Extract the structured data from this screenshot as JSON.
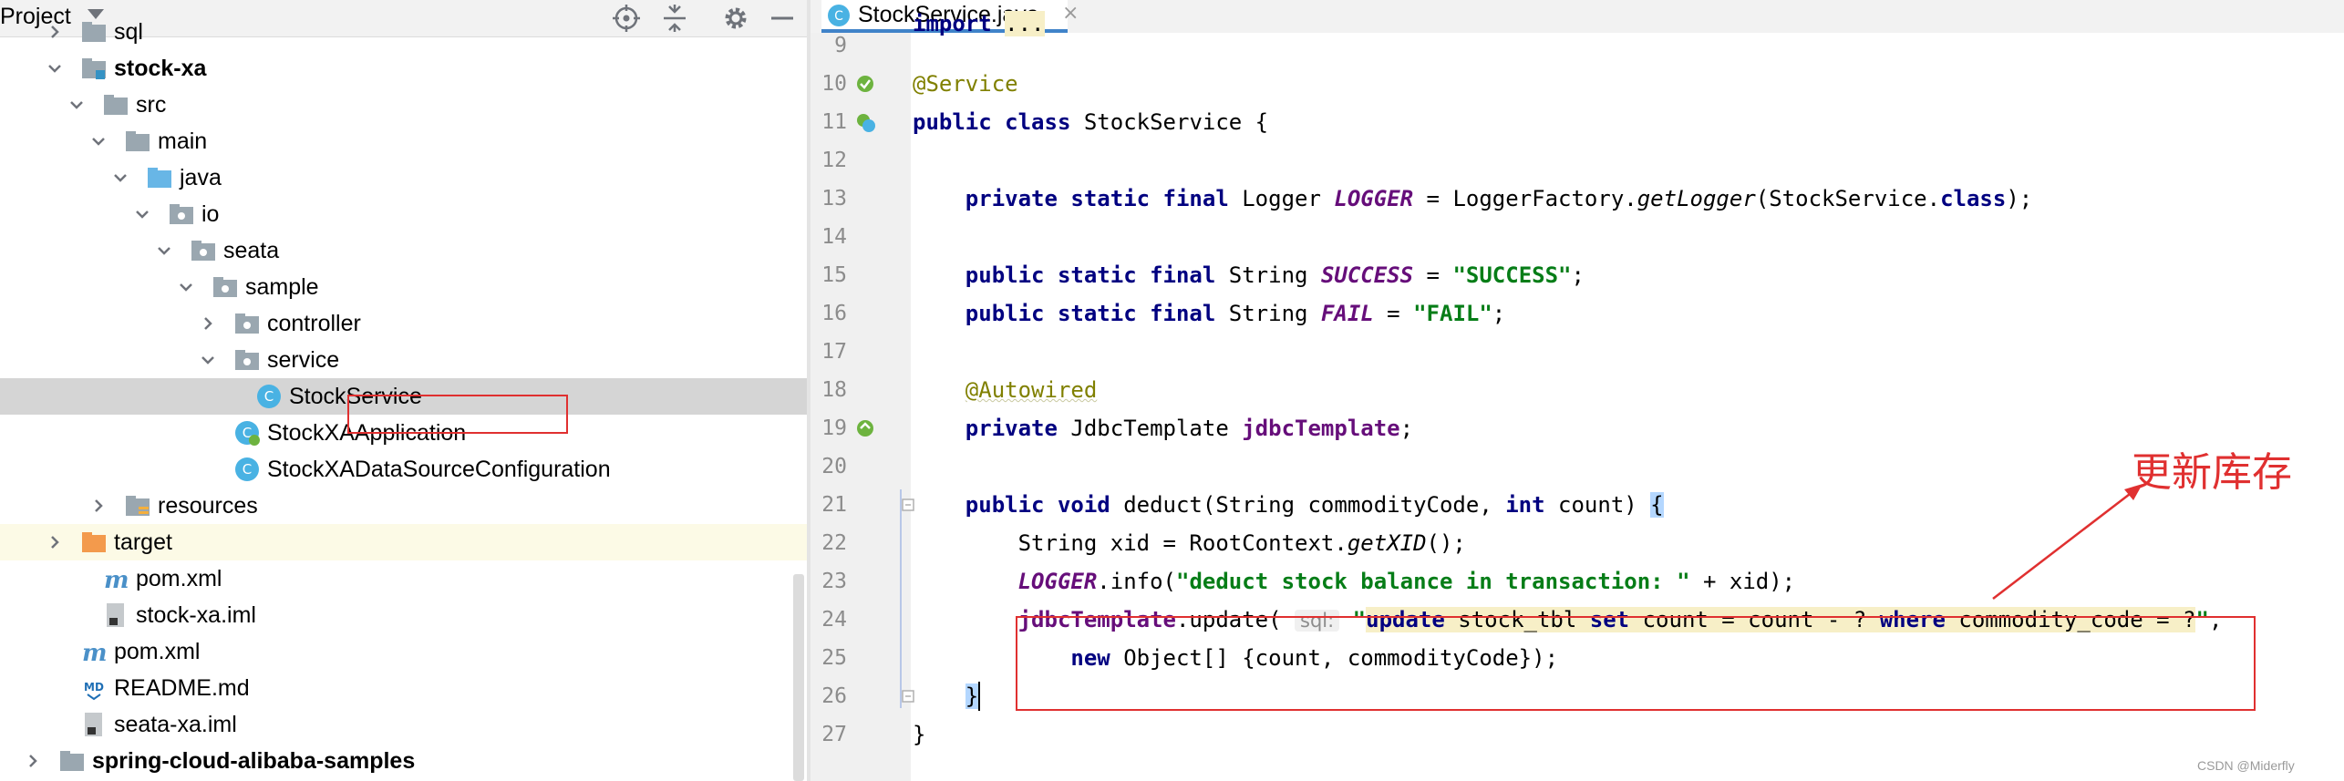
{
  "project": {
    "title": "Project",
    "tree": [
      {
        "label": "sql",
        "icon": "folder-icon",
        "arrow": "right",
        "bold": false
      },
      {
        "label": "stock-xa",
        "icon": "module-folder-icon",
        "arrow": "down",
        "bold": true
      },
      {
        "label": "src",
        "icon": "folder-icon",
        "arrow": "down",
        "bold": false
      },
      {
        "label": "main",
        "icon": "folder-icon",
        "arrow": "down",
        "bold": false
      },
      {
        "label": "java",
        "icon": "source-folder-icon",
        "arrow": "down",
        "bold": false
      },
      {
        "label": "io",
        "icon": "package-icon",
        "arrow": "down",
        "bold": false
      },
      {
        "label": "seata",
        "icon": "package-icon",
        "arrow": "down",
        "bold": false
      },
      {
        "label": "sample",
        "icon": "package-icon",
        "arrow": "down",
        "bold": false
      },
      {
        "label": "controller",
        "icon": "package-icon",
        "arrow": "right",
        "bold": false
      },
      {
        "label": "service",
        "icon": "package-icon",
        "arrow": "down",
        "bold": false
      },
      {
        "label": "StockService",
        "icon": "java-class-icon",
        "arrow": "none",
        "bold": false,
        "selected": true
      },
      {
        "label": "StockXAApplication",
        "icon": "spring-boot-class-icon",
        "arrow": "none",
        "bold": false
      },
      {
        "label": "StockXADataSourceConfiguration",
        "icon": "java-class-icon",
        "arrow": "none",
        "bold": false
      },
      {
        "label": "resources",
        "icon": "resources-folder-icon",
        "arrow": "right",
        "bold": false
      },
      {
        "label": "target",
        "icon": "excluded-folder-icon",
        "arrow": "right",
        "bold": false,
        "excluded": true
      },
      {
        "label": "pom.xml",
        "icon": "maven-icon",
        "arrow": "none",
        "bold": false
      },
      {
        "label": "stock-xa.iml",
        "icon": "iml-file-icon",
        "arrow": "none",
        "bold": false
      },
      {
        "label": "pom.xml",
        "icon": "maven-icon",
        "arrow": "none",
        "bold": false
      },
      {
        "label": "README.md",
        "icon": "markdown-file-icon",
        "arrow": "none",
        "bold": false
      },
      {
        "label": "seata-xa.iml",
        "icon": "iml-file-icon",
        "arrow": "none",
        "bold": false
      },
      {
        "label": "spring-cloud-alibaba-samples",
        "icon": "folder-icon",
        "arrow": "right",
        "bold": true
      }
    ]
  },
  "editor": {
    "tab_label": "StockService.java",
    "tab_close": "×",
    "line_numbers": [
      "9",
      "10",
      "11",
      "12",
      "13",
      "14",
      "15",
      "16",
      "17",
      "18",
      "19",
      "20",
      "21",
      "22",
      "23",
      "24",
      "25",
      "26",
      "27"
    ],
    "top_partial": "import ...",
    "lines": {
      "l10": "@Service",
      "l11_a": "public class ",
      "l11_b": "StockService {",
      "l13_a": "private static final ",
      "l13_b": "Logger ",
      "l13_c": "LOGGER",
      "l13_d": " = LoggerFactory.",
      "l13_e": "getLogger",
      "l13_f": "(StockService.",
      "l13_g": "class",
      "l13_h": ");",
      "l15_a": "public static final ",
      "l15_b": "String ",
      "l15_c": "SUCCESS",
      "l15_d": " = ",
      "l15_e": "\"SUCCESS\"",
      "l15_f": ";",
      "l16_a": "public static final ",
      "l16_b": "String ",
      "l16_c": "FAIL",
      "l16_d": " = ",
      "l16_e": "\"FAIL\"",
      "l16_f": ";",
      "l18": "@Autowired",
      "l19_a": "private ",
      "l19_b": "JdbcTemplate ",
      "l19_c": "jdbcTemplate",
      "l19_d": ";",
      "l21_a": "public void ",
      "l21_b": "deduct(String commodityCode, ",
      "l21_c": "int ",
      "l21_d": "count) ",
      "l21_e": "{",
      "l22_a": "String xid = RootContext.",
      "l22_b": "getXID",
      "l22_c": "();",
      "l23_a": "LOGGER",
      "l23_b": ".info(",
      "l23_c": "\"deduct stock balance in transaction: \"",
      "l23_d": " + xid);",
      "l24_a": "jdbcTemplate",
      "l24_b": ".update( ",
      "l24_hint": "sql:",
      "l24_q1": " \"",
      "l24_k1": "update",
      "l24_t1": " stock_tbl ",
      "l24_k2": "set",
      "l24_t2": " count = count - ? ",
      "l24_k3": "where",
      "l24_t3": " commodity_code = ?",
      "l24_q2": "\"",
      "l24_end": ",",
      "l25_a": "new ",
      "l25_b": "Object[] {count, commodityCode});",
      "l26": "}",
      "l27": "}"
    }
  },
  "annotation": {
    "callout_text": "更新库存",
    "watermark": "CSDN @Miderfly"
  },
  "colors": {
    "accent_red": "#e03030",
    "tab_underline": "#4083c9",
    "keyword": "#000080",
    "string": "#067d17",
    "field": "#660e7a",
    "annotation": "#808000"
  }
}
